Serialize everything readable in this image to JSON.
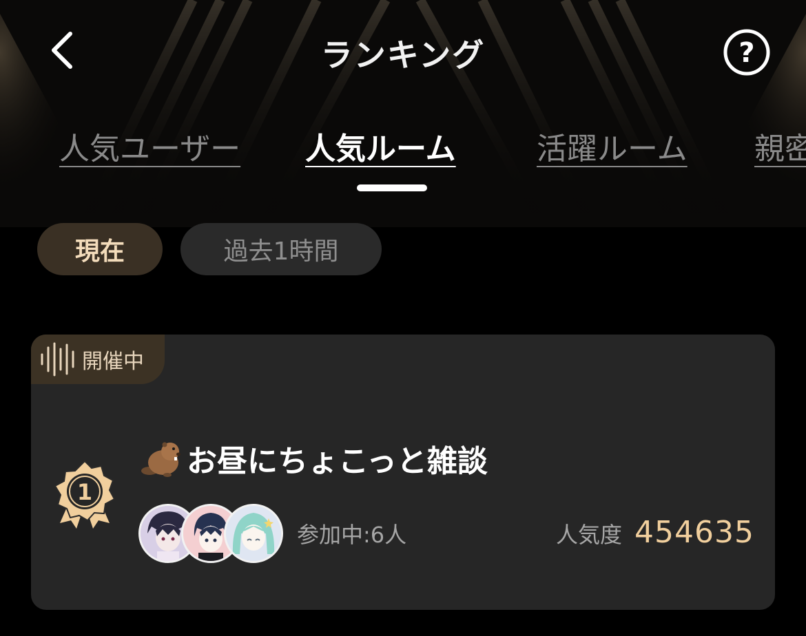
{
  "header": {
    "title": "ランキング",
    "back_icon": "chevron-left-icon",
    "help_icon": "question-circle-icon"
  },
  "tabs": [
    {
      "label": "人気ユーザー",
      "active": false
    },
    {
      "label": "人気ルーム",
      "active": true
    },
    {
      "label": "活躍ルーム",
      "active": false
    },
    {
      "label": "親密",
      "active": false
    }
  ],
  "time_filters": [
    {
      "label": "現在",
      "selected": true
    },
    {
      "label": "過去1時間",
      "selected": false
    }
  ],
  "rooms": [
    {
      "status": "開催中",
      "rank": "1",
      "title": "お昼にちょこっと雑談",
      "title_icon": "beaver-icon",
      "participants": "参加中:6人",
      "popularity_label": "人気度",
      "popularity_value": "454635"
    }
  ],
  "colors": {
    "background": "#000000",
    "card": "#262626",
    "accent_gold": "#f1cf9d",
    "pill_selected_bg": "#3a3024",
    "pill_unselected_bg": "#2a2a2a"
  }
}
